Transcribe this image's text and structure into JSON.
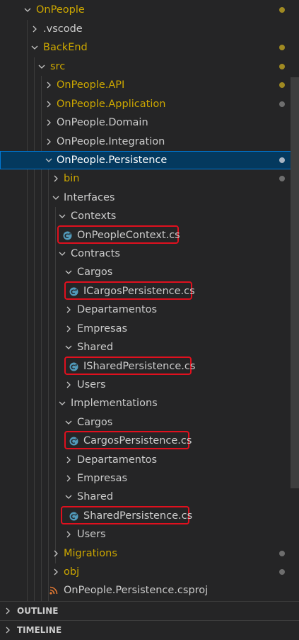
{
  "explorer": {
    "root": "OnPeople",
    "vscode": ".vscode",
    "backend": "BackEnd",
    "src": "src",
    "api": "OnPeople.API",
    "application": "OnPeople.Application",
    "domain": "OnPeople.Domain",
    "integration": "OnPeople.Integration",
    "persistence": "OnPeople.Persistence",
    "bin": "bin",
    "interfaces": "Interfaces",
    "contexts": "Contexts",
    "context_file": "OnPeopleContext.cs",
    "contracts": "Contracts",
    "contracts_cargos": "Cargos",
    "icargos_file": "ICargosPersistence.cs",
    "contracts_departamentos": "Departamentos",
    "contracts_empresas": "Empresas",
    "contracts_shared": "Shared",
    "ishared_file": "ISharedPersistence.cs",
    "contracts_users": "Users",
    "implementations": "Implementations",
    "impl_cargos": "Cargos",
    "cargos_file": "CargosPersistence.cs",
    "impl_departamentos": "Departamentos",
    "impl_empresas": "Empresas",
    "impl_shared": "Shared",
    "shared_file": "SharedPersistence.cs",
    "impl_users": "Users",
    "migrations": "Migrations",
    "obj": "obj",
    "csproj": "OnPeople.Persistence.csproj"
  },
  "panels": {
    "outline": "OUTLINE",
    "timeline": "TIMELINE"
  },
  "colors": {
    "background": "#252526",
    "selection": "#04395e",
    "modified_text": "#cca700",
    "highlight_box": "#e0101e",
    "csharp_icon": "#519aba",
    "rss_icon": "#e37933"
  }
}
